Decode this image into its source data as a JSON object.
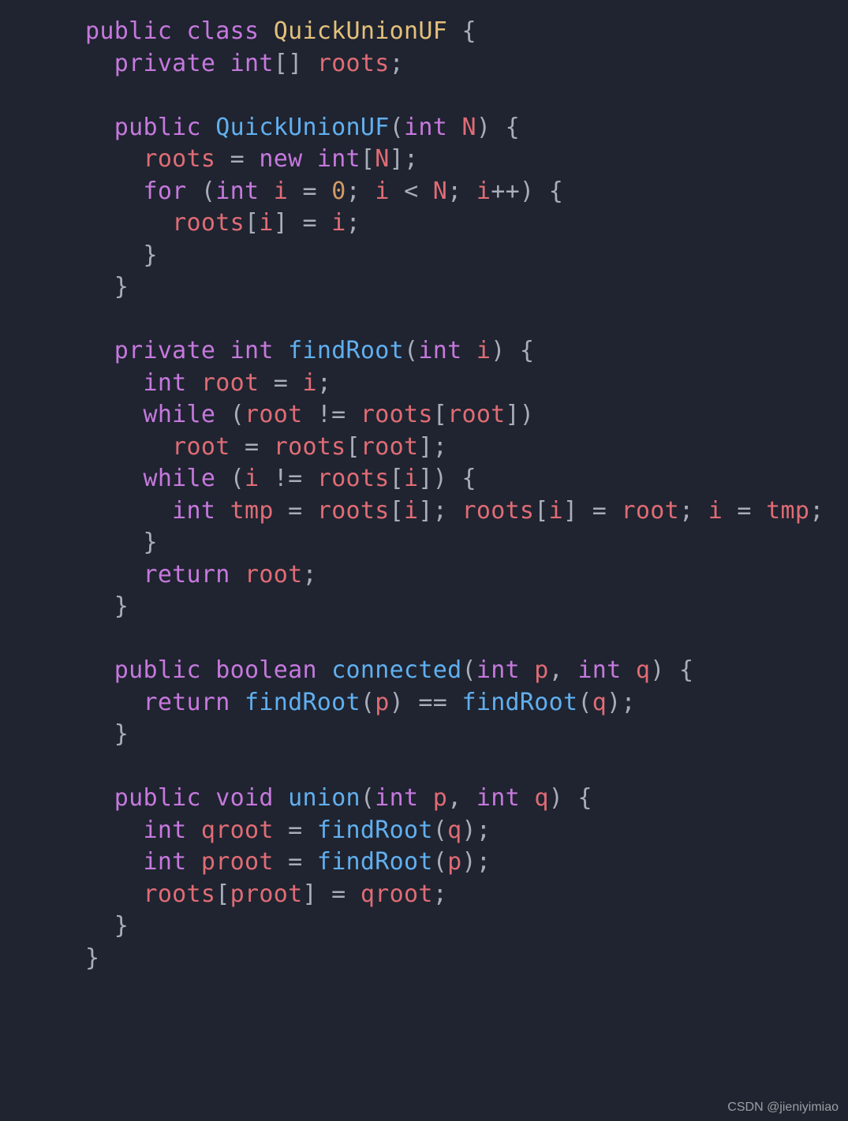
{
  "code": {
    "kw_public": "public",
    "kw_class": "class",
    "kw_private": "private",
    "kw_new": "new",
    "kw_for": "for",
    "kw_while": "while",
    "kw_return": "return",
    "ty_int": "int",
    "ty_void": "void",
    "ty_boolean": "boolean",
    "cl_name": "QuickUnionUF",
    "fn_ctor": "QuickUnionUF",
    "fn_findRoot": "findRoot",
    "fn_connected": "connected",
    "fn_union": "union",
    "va_roots": "roots",
    "va_N": "N",
    "va_i": "i",
    "va_root": "root",
    "va_tmp": "tmp",
    "va_p": "p",
    "va_q": "q",
    "va_qroot": "qroot",
    "va_proot": "proot",
    "nu_0": "0"
  },
  "watermark": "CSDN @jieniyimiao"
}
